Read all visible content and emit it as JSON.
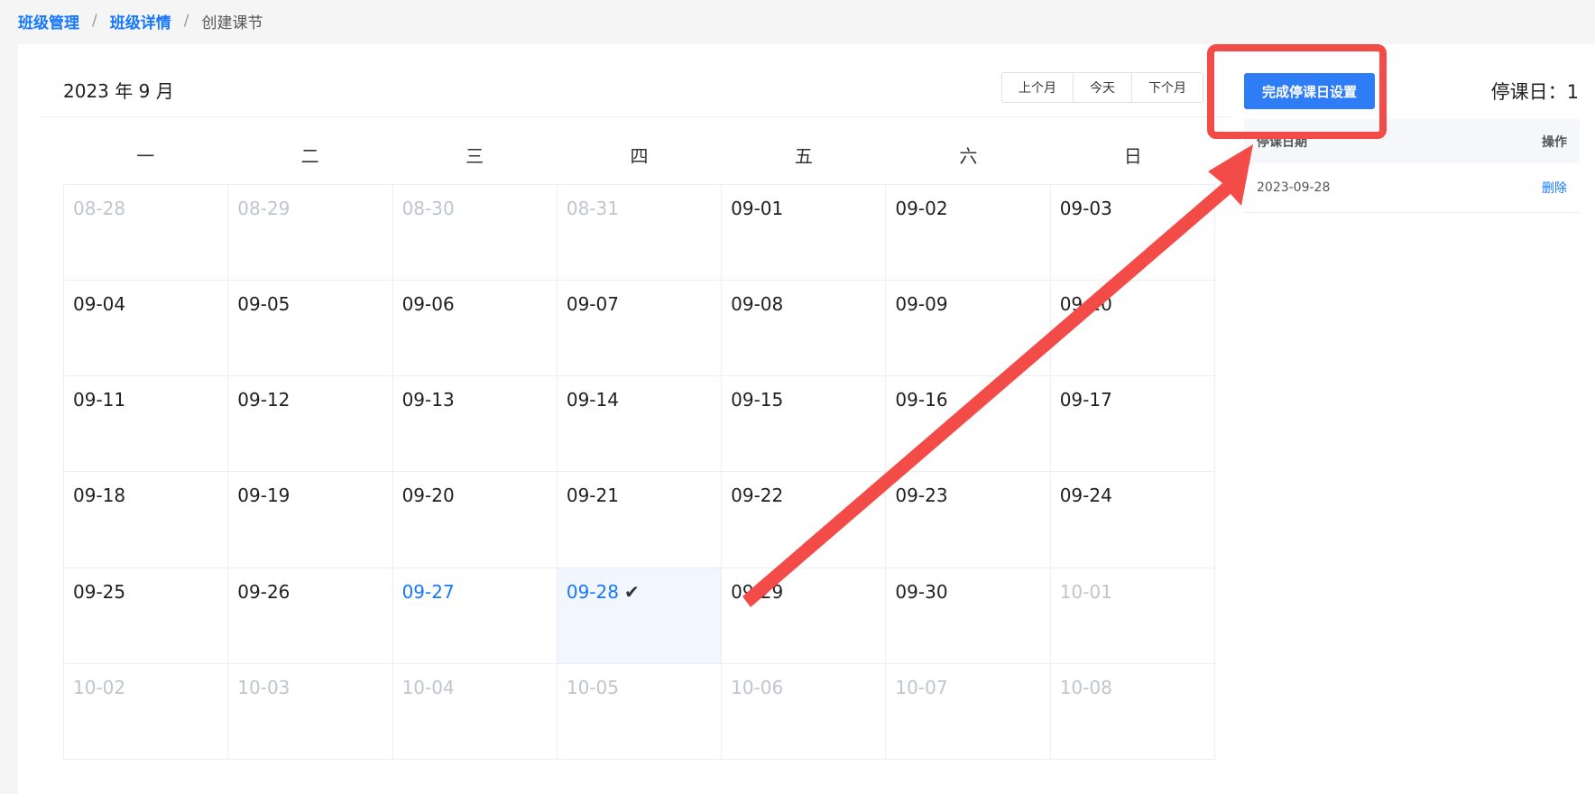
{
  "breadcrumb": {
    "items": [
      {
        "label": "班级管理",
        "link": true
      },
      {
        "label": "班级详情",
        "link": true
      },
      {
        "label": "创建课节",
        "link": false
      }
    ],
    "separator": "/"
  },
  "calendar": {
    "title": "2023 年 9 月",
    "nav": {
      "prev": "上个月",
      "today": "今天",
      "next": "下个月"
    },
    "weekdays": [
      "一",
      "二",
      "三",
      "四",
      "五",
      "六",
      "日"
    ],
    "days": [
      {
        "label": "08-28",
        "state": "other"
      },
      {
        "label": "08-29",
        "state": "other"
      },
      {
        "label": "08-30",
        "state": "other"
      },
      {
        "label": "08-31",
        "state": "other"
      },
      {
        "label": "09-01",
        "state": "current"
      },
      {
        "label": "09-02",
        "state": "current"
      },
      {
        "label": "09-03",
        "state": "current"
      },
      {
        "label": "09-04",
        "state": "current"
      },
      {
        "label": "09-05",
        "state": "current"
      },
      {
        "label": "09-06",
        "state": "current"
      },
      {
        "label": "09-07",
        "state": "current"
      },
      {
        "label": "09-08",
        "state": "current"
      },
      {
        "label": "09-09",
        "state": "current"
      },
      {
        "label": "09-10",
        "state": "current"
      },
      {
        "label": "09-11",
        "state": "current"
      },
      {
        "label": "09-12",
        "state": "current"
      },
      {
        "label": "09-13",
        "state": "current"
      },
      {
        "label": "09-14",
        "state": "current"
      },
      {
        "label": "09-15",
        "state": "current"
      },
      {
        "label": "09-16",
        "state": "current"
      },
      {
        "label": "09-17",
        "state": "current"
      },
      {
        "label": "09-18",
        "state": "current"
      },
      {
        "label": "09-19",
        "state": "current"
      },
      {
        "label": "09-20",
        "state": "current"
      },
      {
        "label": "09-21",
        "state": "current"
      },
      {
        "label": "09-22",
        "state": "current"
      },
      {
        "label": "09-23",
        "state": "current"
      },
      {
        "label": "09-24",
        "state": "current"
      },
      {
        "label": "09-25",
        "state": "current"
      },
      {
        "label": "09-26",
        "state": "current"
      },
      {
        "label": "09-27",
        "state": "highlight"
      },
      {
        "label": "09-28",
        "state": "selected",
        "check": "✔"
      },
      {
        "label": "09-29",
        "state": "current"
      },
      {
        "label": "09-30",
        "state": "current"
      },
      {
        "label": "10-01",
        "state": "other"
      },
      {
        "label": "10-02",
        "state": "other"
      },
      {
        "label": "10-03",
        "state": "other"
      },
      {
        "label": "10-04",
        "state": "other"
      },
      {
        "label": "10-05",
        "state": "other"
      },
      {
        "label": "10-06",
        "state": "other"
      },
      {
        "label": "10-07",
        "state": "other"
      },
      {
        "label": "10-08",
        "state": "other"
      }
    ]
  },
  "sidepanel": {
    "done_button": "完成停课日设置",
    "stop_count": "停课日：1",
    "table": {
      "headers": [
        "停课日期",
        "操作"
      ],
      "rows": [
        {
          "date": "2023-09-28",
          "action": "删除"
        }
      ]
    }
  },
  "colors": {
    "accent": "#1677ff",
    "button": "#2e7cf6",
    "annotation": "#f24b48",
    "muted": "#c0c4cc",
    "selected_bg": "#f2f7ff"
  }
}
